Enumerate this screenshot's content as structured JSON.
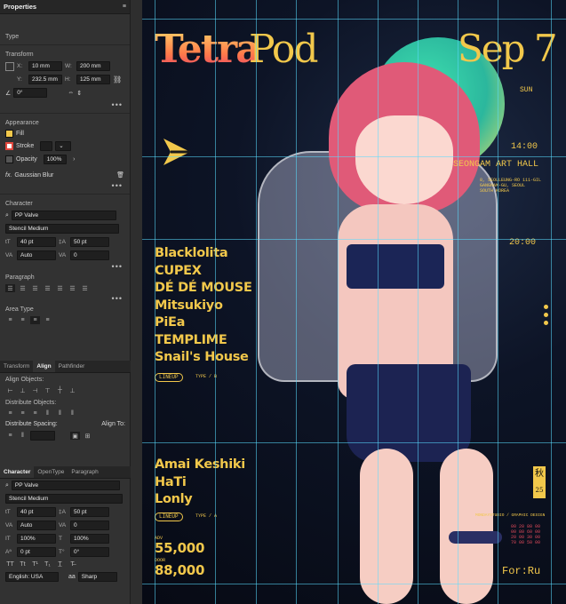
{
  "properties_panel": {
    "tab_title": "Properties",
    "type_label": "Type",
    "transform": {
      "title": "Transform",
      "x_label": "X:",
      "x_value": "10 mm",
      "w_label": "W:",
      "w_value": "200 mm",
      "y_label": "Y:",
      "y_value": "232.5 mm",
      "h_label": "H:",
      "h_value": "125 mm",
      "angle_value": "0°"
    },
    "appearance": {
      "title": "Appearance",
      "fill_label": "Fill",
      "stroke_label": "Stroke",
      "opacity_label": "Opacity",
      "opacity_value": "100%",
      "effect_label": "Gaussian Blur",
      "fill_color": "#f2c84b",
      "stroke_color": "#e0473d"
    },
    "character": {
      "title": "Character",
      "font_family": "PP Valve",
      "font_style": "Stencil Medium",
      "size_value": "40 pt",
      "leading_value": "50 pt",
      "kerning_value": "Auto",
      "tracking_value": "0"
    },
    "paragraph": {
      "title": "Paragraph"
    },
    "area_type": {
      "title": "Area Type"
    }
  },
  "align_panel": {
    "tabs": [
      "Transform",
      "Align",
      "Pathfinder"
    ],
    "align_objects_label": "Align Objects:",
    "distribute_objects_label": "Distribute Objects:",
    "distribute_spacing_label": "Distribute Spacing:",
    "align_to_label": "Align To:"
  },
  "character_panel": {
    "tabs": [
      "Character",
      "OpenType",
      "Paragraph"
    ],
    "font_family": "PP Valve",
    "font_style": "Stencil Medium",
    "size_value": "40 pt",
    "leading_value": "50 pt",
    "kerning_value": "Auto",
    "tracking_value": "0",
    "vscale_value": "100%",
    "hscale_value": "100%",
    "baseline_value": "0 pt",
    "rotation_value": "0°",
    "language_value": "English: USA",
    "antialias_value": "Sharp"
  },
  "poster": {
    "title_part1": "Tetra",
    "title_part2": "Pod",
    "date": "Sep 7",
    "day": "SUN",
    "time1": "14:00",
    "venue": "SEONGAM ART HALL",
    "time2": "20:00",
    "lineup": [
      "Blacklolita",
      "CUPEX",
      "DÉ DÉ MOUSE",
      "Mitsukiyo",
      "PiEa",
      "TEMPLIME",
      "Snail's House"
    ],
    "lineup2": [
      "Amai Keshiki",
      "HaTi",
      "Lonly"
    ],
    "price1_label": "ADV",
    "price1": "55,000",
    "price2_label": "DOOR",
    "price2": "88,000",
    "credit": "For:Ru",
    "kanji": "秋",
    "kanji_num": "25",
    "tag1": "LINEUP",
    "tag2": "LINEUP",
    "type_b": "TYPE / B",
    "type_a": "TYPE / A",
    "design_credit": "MONDAYSTUDIO / GRAPHIC DESIGN",
    "color_codes": [
      "00 20 80 00",
      "00 80 60 00",
      "20 00 30 00",
      "70 00 50 00"
    ],
    "address": [
      "8, SEOLLEUNG-RO 111-GIL",
      "GANGNAM-GU, SEOUL",
      "SOUTH KOREA"
    ]
  }
}
